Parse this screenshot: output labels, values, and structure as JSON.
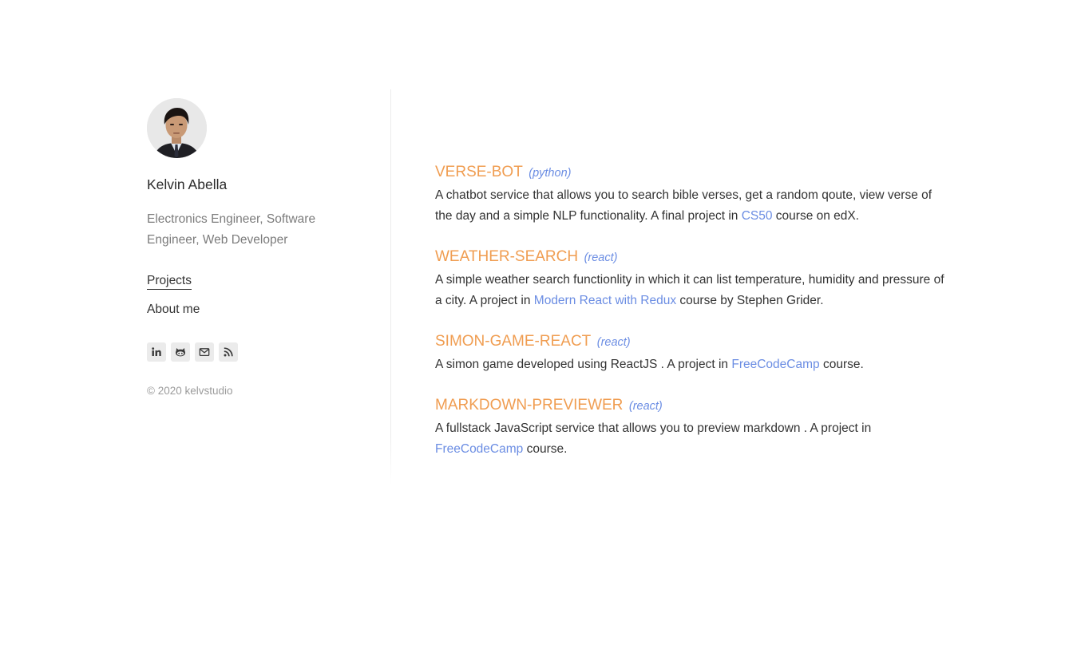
{
  "profile": {
    "name": "Kelvin Abella",
    "bio": "Electronics Engineer, Software Engineer, Web Developer",
    "avatar_alt": "Kelvin Abella portrait"
  },
  "nav": {
    "projects_label": "Projects",
    "about_label": "About me"
  },
  "social": [
    {
      "icon": "linkedin-icon",
      "label": "in"
    },
    {
      "icon": "github-icon",
      "label": ""
    },
    {
      "icon": "mail-icon",
      "label": ""
    },
    {
      "icon": "rss-icon",
      "label": ""
    }
  ],
  "footer": {
    "copyright": "© 2020 kelvstudio"
  },
  "colors": {
    "title": "#f09d51",
    "link": "#6b8de3",
    "text": "#333333",
    "muted": "#7c7c7c"
  },
  "projects": [
    {
      "title": "VERSE-BOT",
      "lang": "(python)",
      "desc_before": "A chatbot service that allows you to search bible verses, get a random qoute, view verse of the day and a simple NLP functionality. A final project in ",
      "link": "CS50",
      "desc_after": " course on edX."
    },
    {
      "title": "WEATHER-SEARCH",
      "lang": "(react)",
      "desc_before": "A simple weather search functionlity in which it can list temperature, humidity and pressure of a city. A project in ",
      "link": "Modern React with Redux",
      "desc_after": " course by Stephen Grider."
    },
    {
      "title": "SIMON-GAME-REACT",
      "lang": "(react)",
      "desc_before": "A simon game developed using ReactJS . A project in ",
      "link": "FreeCodeCamp",
      "desc_after": " course."
    },
    {
      "title": "MARKDOWN-PREVIEWER",
      "lang": "(react)",
      "desc_before": "A fullstack JavaScript service that allows you to preview markdown . A project in ",
      "link": "FreeCodeCamp",
      "desc_after": " course."
    }
  ]
}
